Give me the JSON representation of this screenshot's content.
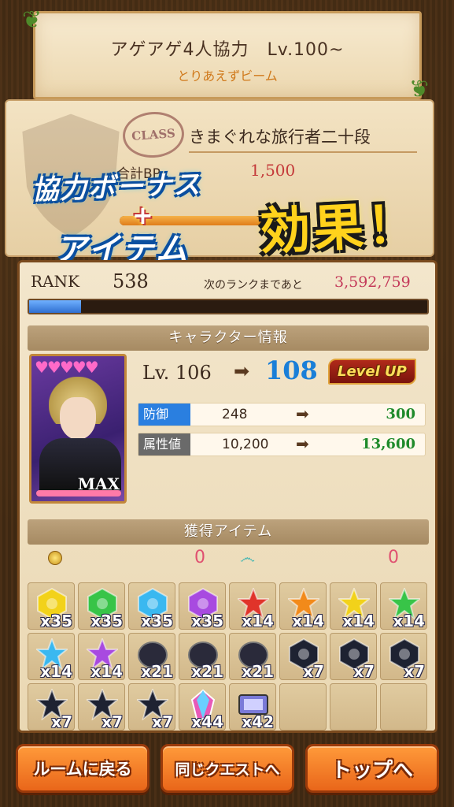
{
  "quest": {
    "title": "アゲアゲ4人協力　Lv.100~",
    "subtitle": "とりあえずビーム"
  },
  "class_panel": {
    "stamp": "CLASS",
    "name": "きまぐれな旅行者二十段",
    "bp_label": "合計BP",
    "bp_value": "1,500",
    "progress_fraction": 0.85
  },
  "promo": {
    "line1": "協力ボーナス",
    "plus": "+",
    "line2": "アイテム",
    "effect": "効果！"
  },
  "rank": {
    "label": "RANK",
    "value": "538",
    "next_label": "次のランクまであと",
    "next_value": "3,592,759",
    "progress_fraction": 0.13
  },
  "character": {
    "section_title": "キャラクター情報",
    "hearts": "♥♥♥♥♥",
    "max_label": "MAX",
    "lv_prefix": "Lv. 106",
    "lv_new": "108",
    "levelup": "Level UP",
    "stats": [
      {
        "name": "防御",
        "old": "248",
        "new": "300",
        "color": "#2a7fe0"
      },
      {
        "name": "属性値",
        "old": "10,200",
        "new": "13,600",
        "color": "#6a6a6a"
      }
    ]
  },
  "items": {
    "section_title": "獲得アイテム",
    "coin_zero": "0",
    "spiral_zero": "0",
    "gems": [
      {
        "icon": "yellow-hex-gem-icon",
        "color": "#f2d21a",
        "shape": "hex",
        "count": "x35"
      },
      {
        "icon": "green-hex-gem-icon",
        "color": "#38c448",
        "shape": "hex",
        "count": "x35"
      },
      {
        "icon": "blue-hex-gem-icon",
        "color": "#3ab8f0",
        "shape": "hex",
        "count": "x35"
      },
      {
        "icon": "purple-hex-gem-icon",
        "color": "#a84ae0",
        "shape": "hex",
        "count": "x35"
      },
      {
        "icon": "red-star-gem-icon",
        "color": "#e0342a",
        "shape": "star",
        "count": "x14"
      },
      {
        "icon": "orange-star-gem-icon",
        "color": "#f28a1a",
        "shape": "star",
        "count": "x14"
      },
      {
        "icon": "yellow-star-gem-icon",
        "color": "#f2d21a",
        "shape": "star",
        "count": "x14"
      },
      {
        "icon": "green-star-gem-icon",
        "color": "#38c448",
        "shape": "star",
        "count": "x14"
      },
      {
        "icon": "blue-star-gem-icon",
        "color": "#3ab8f0",
        "shape": "star",
        "count": "x14"
      },
      {
        "icon": "purple-star-gem-icon",
        "color": "#a84ae0",
        "shape": "star",
        "count": "x14"
      },
      {
        "icon": "dark-stone-red-icon",
        "color": "#2a2a3a",
        "shape": "stone",
        "count": "x21"
      },
      {
        "icon": "dark-stone-yellow-icon",
        "color": "#2a2a3a",
        "shape": "stone",
        "count": "x21"
      },
      {
        "icon": "dark-stone-green-icon",
        "color": "#2a2a3a",
        "shape": "stone",
        "count": "x21"
      },
      {
        "icon": "dark-hex-red-icon",
        "color": "#1e2232",
        "shape": "hex",
        "count": "x7"
      },
      {
        "icon": "dark-hex-yellow-icon",
        "color": "#1e2232",
        "shape": "hex",
        "count": "x7"
      },
      {
        "icon": "dark-hex-green-icon",
        "color": "#1e2232",
        "shape": "hex",
        "count": "x7"
      },
      {
        "icon": "dark-star-red-icon",
        "color": "#1e2232",
        "shape": "star",
        "count": "x7"
      },
      {
        "icon": "dark-star-yellow-icon",
        "color": "#1e2232",
        "shape": "star",
        "count": "x7"
      },
      {
        "icon": "dark-star-green-icon",
        "color": "#1e2232",
        "shape": "star",
        "count": "x7"
      },
      {
        "icon": "rainbow-crystal-icon",
        "color": "#e85ab8",
        "shape": "crystal",
        "count": "x44"
      },
      {
        "icon": "ticket-icon",
        "color": "#7a7ad8",
        "shape": "ticket",
        "count": "x42"
      },
      {
        "icon": "",
        "color": "",
        "shape": "empty",
        "count": ""
      },
      {
        "icon": "",
        "color": "",
        "shape": "empty",
        "count": ""
      },
      {
        "icon": "",
        "color": "",
        "shape": "empty",
        "count": ""
      }
    ]
  },
  "buttons": {
    "room": "ルームに戻る",
    "same_quest": "同じクエストへ",
    "top": "トップへ"
  }
}
